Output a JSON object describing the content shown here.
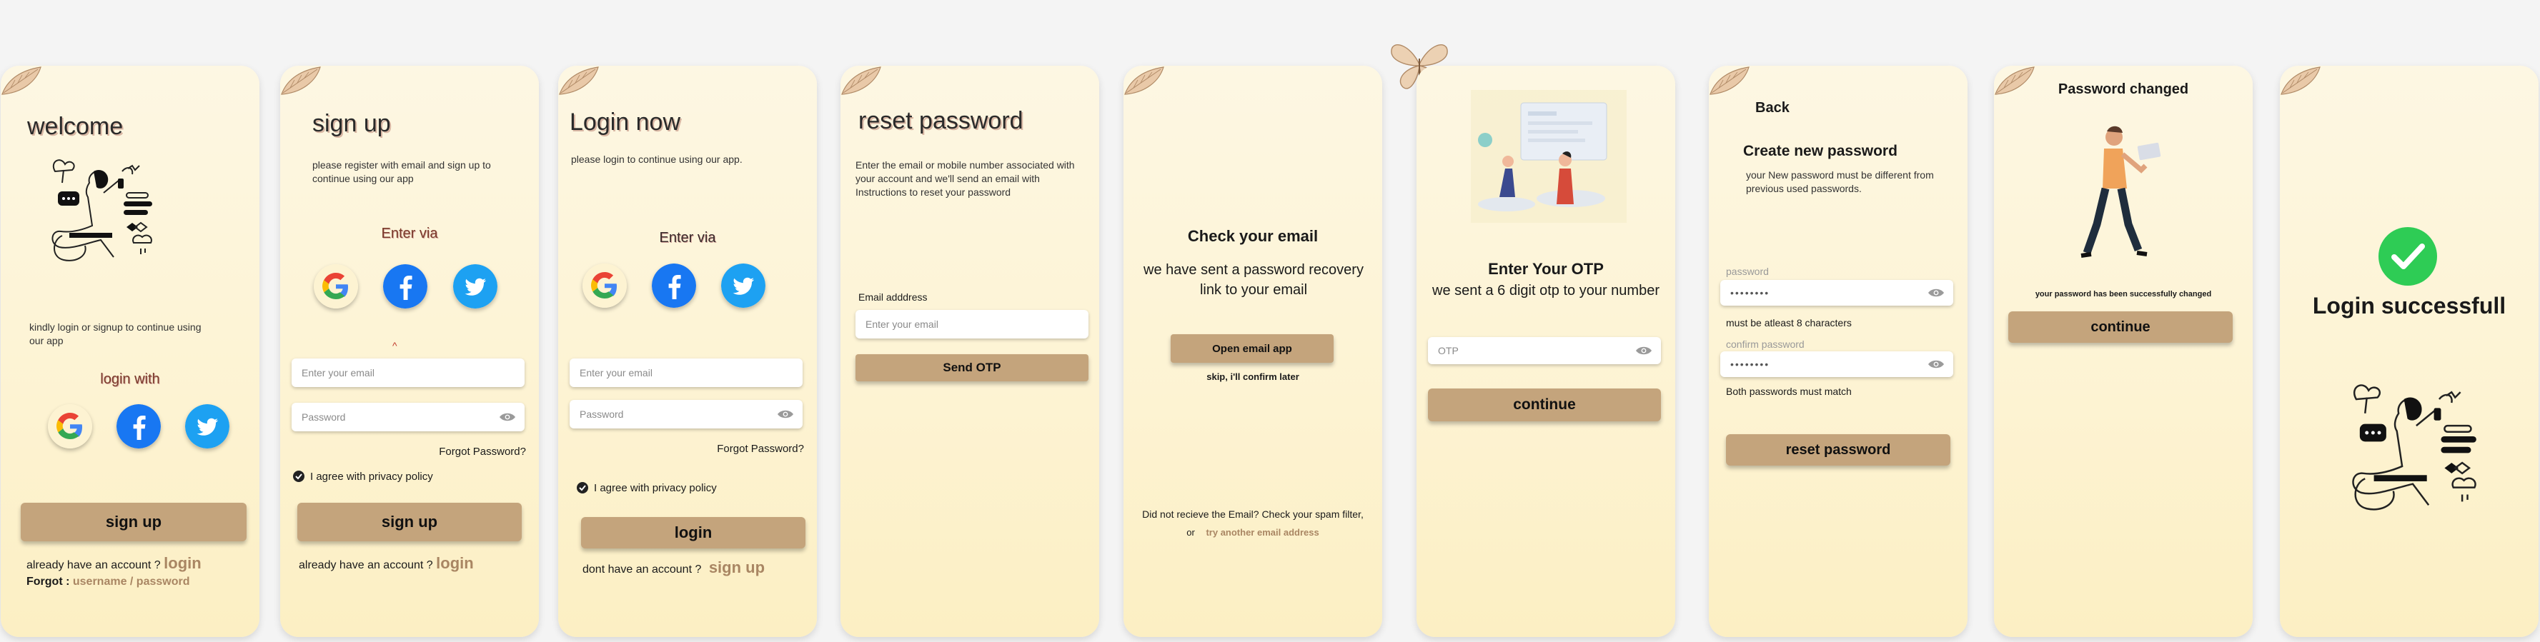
{
  "colors": {
    "accent": "#c4a47c",
    "link": "#a98663",
    "bg_top": "#fdf7e3",
    "bg_bottom": "#fcefc3",
    "success": "#2ecc55"
  },
  "s1": {
    "title": "welcome",
    "desc": "kindly login or signup to continue using our app",
    "login_with": "login with",
    "signup_btn": "sign up",
    "already_prefix": "already have an account ?",
    "login_link": "login",
    "forgot_prefix": "Forgot :",
    "forgot_link": "username / password"
  },
  "s2": {
    "title": "sign up",
    "desc": "please register with email and sign up to continue using our app",
    "enter_via": "Enter via",
    "caret": "^",
    "email_ph": "Enter your email",
    "password_ph": "Password",
    "forgot": "Forgot Password?",
    "agree": "I agree with privacy policy",
    "signup_btn": "sign up",
    "already_prefix": "already have an account ?",
    "login_link": "login"
  },
  "s3": {
    "title": "Login now",
    "desc": "please login to continue using our app.",
    "enter_via": "Enter via",
    "email_ph": "Enter your email",
    "password_ph": "Password",
    "forgot": "Forgot Password?",
    "agree": "I agree with privacy policy",
    "login_btn": "login",
    "no_account_prefix": "dont have an account ?",
    "signup_link": "sign up"
  },
  "s4": {
    "title": "reset password",
    "desc": "Enter the email or mobile number associated with your account and we'll send an email with Instructions to reset your password",
    "email_label": "Email adddress",
    "email_ph": "Enter your email",
    "send_btn": "Send OTP"
  },
  "s5": {
    "heading": "Check your email",
    "body": "we have sent a  password recovery link to your email",
    "open_btn": "Open email app",
    "skip": "skip, i'll confirm later",
    "spam_note": "Did not recieve the Email? Check your spam filter,",
    "or_prefix": "or",
    "try_link": "try another email address"
  },
  "s6": {
    "heading": "Enter Your OTP",
    "body": "we sent a 6 digit otp to your number",
    "otp_ph": "OTP",
    "continue_btn": "continue"
  },
  "s7": {
    "back": "Back",
    "heading": "Create new password",
    "desc": "your New password must be different from previous used passwords.",
    "pw_label": "password",
    "pw_value": "••••••••",
    "pw_hint": "must be atleast 8 characters",
    "confirm_label": "confirm password",
    "confirm_value": "••••••••",
    "confirm_hint": "Both passwords must match",
    "reset_btn": "reset password"
  },
  "s8": {
    "heading": "Password changed",
    "message": "your password has been successfully changed",
    "continue_btn": "continue"
  },
  "s9": {
    "heading": "Login successfull"
  }
}
